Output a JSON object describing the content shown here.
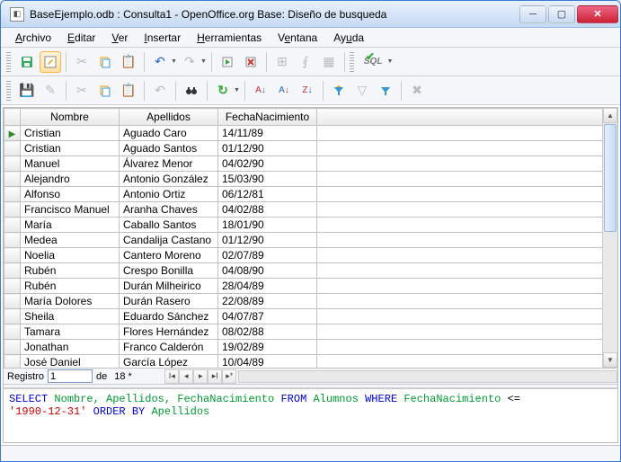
{
  "window": {
    "title": "BaseEjemplo.odb : Consulta1 - OpenOffice.org Base: Diseño de busqueda"
  },
  "menu": {
    "archivo": "Archivo",
    "editar": "Editar",
    "ver": "Ver",
    "insertar": "Insertar",
    "herramientas": "Herramientas",
    "ventana": "Ventana",
    "ayuda": "Ayuda"
  },
  "toolbar1": {
    "save": "💾",
    "edit": "✏",
    "cut": "✂",
    "copy": "⧉",
    "paste": "📋",
    "undo": "↶",
    "redo": "↷",
    "run": "▶",
    "clear": "✖",
    "addtable": "⊞",
    "func": "fx",
    "design": "□",
    "sql": "SQL"
  },
  "toolbar2": {
    "save2": "💾",
    "edit2": "✏",
    "cut2": "✂",
    "copy2": "⧉",
    "paste2": "📋",
    "undo2": "↶",
    "find": "🔍",
    "refresh": "↻",
    "sortasc": "A↓",
    "sortdesc": "A↑",
    "autofilter": "▼",
    "filter": "⚡",
    "removefilter": "▽",
    "apply": "✓"
  },
  "columns": {
    "nombre": "Nombre",
    "apellidos": "Apellidos",
    "fecha": "FechaNacimiento"
  },
  "rows": [
    {
      "n": "Cristian",
      "a": "Aguado Caro",
      "f": "14/11/89"
    },
    {
      "n": "Cristian",
      "a": "Aguado Santos",
      "f": "01/12/90"
    },
    {
      "n": "Manuel",
      "a": "Álvarez Menor",
      "f": "04/02/90"
    },
    {
      "n": "Alejandro",
      "a": "Antonio González",
      "f": "15/03/90"
    },
    {
      "n": "Alfonso",
      "a": "Antonio Ortiz",
      "f": "06/12/81"
    },
    {
      "n": "Francisco Manuel",
      "a": "Aranha Chaves",
      "f": "04/02/88"
    },
    {
      "n": "María",
      "a": "Caballo Santos",
      "f": "18/01/90"
    },
    {
      "n": "Medea",
      "a": "Candalija Castano",
      "f": "01/12/90"
    },
    {
      "n": "Noelia",
      "a": "Cantero Moreno",
      "f": "02/07/89"
    },
    {
      "n": "Rubén",
      "a": "Crespo Bonilla",
      "f": "04/08/90"
    },
    {
      "n": "Rubén",
      "a": "Durán Milheirico",
      "f": "28/04/89"
    },
    {
      "n": "María Dolores",
      "a": "Durán Rasero",
      "f": "22/08/89"
    },
    {
      "n": "Sheila",
      "a": "Eduardo Sánchez",
      "f": "04/07/87"
    },
    {
      "n": "Tamara",
      "a": "Flores Hernández",
      "f": "08/02/88"
    },
    {
      "n": "Jonathan",
      "a": "Franco Calderón",
      "f": "19/02/89"
    },
    {
      "n": "José Daniel",
      "a": "García López",
      "f": "10/04/89"
    }
  ],
  "nav": {
    "label_registro": "Registro",
    "current": "1",
    "label_de": "de",
    "total": "18 *"
  },
  "sql": {
    "select": "SELECT",
    "fields": "Nombre, Apellidos, FechaNacimiento",
    "from": "FROM",
    "table": "Alumnos",
    "where": "WHERE",
    "cond_field": "FechaNacimiento",
    "op": "<=",
    "value": "'1990-12-31'",
    "orderby": "ORDER BY",
    "orderfield": "Apellidos"
  }
}
